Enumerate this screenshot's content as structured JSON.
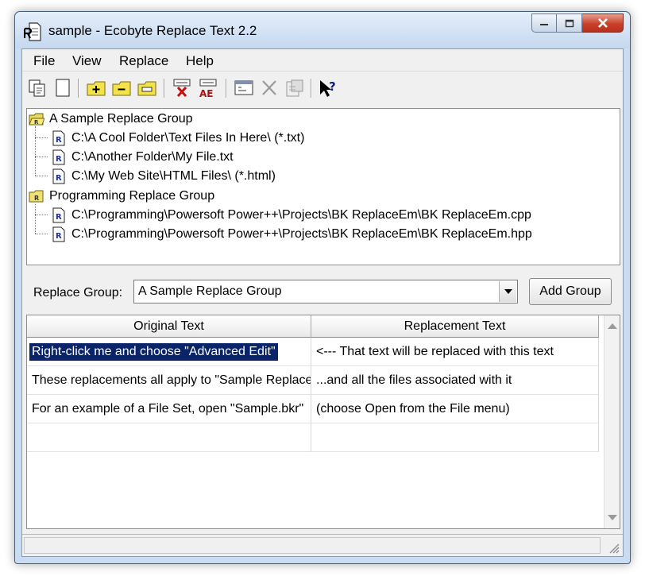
{
  "window": {
    "title": "sample - Ecobyte Replace Text 2.2",
    "app_icon": "ecobyte-r-document-icon"
  },
  "menu": [
    "File",
    "View",
    "Replace",
    "Help"
  ],
  "toolbar": {
    "icons": [
      "copy-pages-icon",
      "new-document-icon",
      "folder-add-icon",
      "folder-remove-icon",
      "folder-rename-icon",
      "replace-x-icon",
      "replace-ae-icon",
      "advanced-edit-icon",
      "delete-icon",
      "properties-icon",
      "whats-this-help-icon"
    ]
  },
  "tree": {
    "groups": [
      {
        "label": "A Sample Replace Group",
        "files": [
          "C:\\A Cool Folder\\Text Files In Here\\ (*.txt)",
          "C:\\Another Folder\\My File.txt",
          "C:\\My Web Site\\HTML Files\\ (*.html)"
        ]
      },
      {
        "label": "Programming Replace Group",
        "files": [
          "C:\\Programming\\Powersoft Power++\\Projects\\BK ReplaceEm\\BK ReplaceEm.cpp",
          "C:\\Programming\\Powersoft Power++\\Projects\\BK ReplaceEm\\BK ReplaceEm.hpp"
        ]
      }
    ]
  },
  "replace_group": {
    "label": "Replace Group:",
    "selected": "A Sample Replace Group",
    "add_button": "Add Group"
  },
  "grid": {
    "columns": [
      "Original Text",
      "Replacement Text"
    ],
    "rows": [
      [
        "Right-click me and choose \"Advanced Edit\"",
        "<--- That text will be replaced with this text"
      ],
      [
        "These replacements all apply to \"Sample Replace Group\"",
        "...and all the files associated with it"
      ],
      [
        "For an example of a File Set, open \"Sample.bkr\"",
        "(choose Open from the File menu)"
      ],
      [
        "",
        ""
      ]
    ],
    "selected_row": 0
  },
  "colors": {
    "selection": "#0a246a",
    "close_button": "#c9402a",
    "titlebar": "#c5d8ef"
  }
}
